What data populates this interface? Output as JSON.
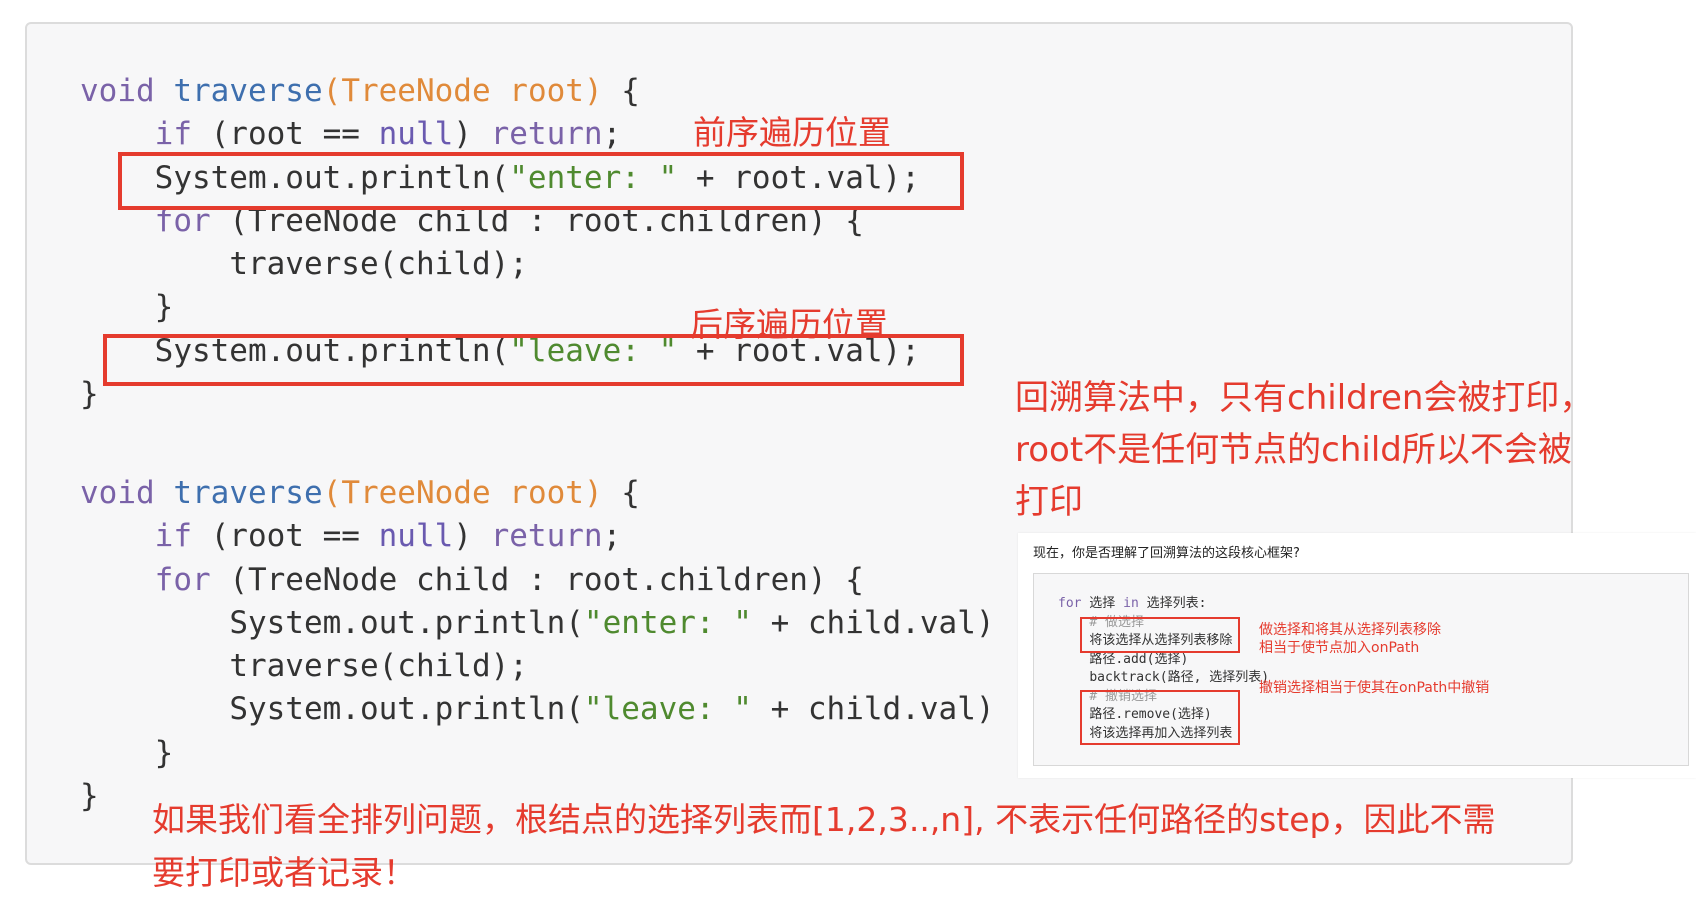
{
  "code1": {
    "l1": {
      "kw": "void",
      "fn": "traverse",
      "open": "(",
      "type": "TreeNode",
      "arg": "root",
      "close": ")",
      "rest": " {"
    },
    "l2": {
      "kw1": "if",
      "a": " (root == ",
      "null": "null",
      "b": ") ",
      "kw2": "return",
      "c": ";"
    },
    "l3": {
      "a": "System.out.println(",
      "str": "\"enter: \"",
      "b": " + root.val);"
    },
    "l4": {
      "kw": "for",
      "rest": " (TreeNode child : root.children) {"
    },
    "l5": "traverse(child);",
    "l6": "}",
    "l7": {
      "a": "System.out.println(",
      "str": "\"leave: \"",
      "b": " + root.val);"
    },
    "l8": "}"
  },
  "code2": {
    "l1": {
      "kw": "void",
      "fn": "traverse",
      "open": "(",
      "type": "TreeNode",
      "arg": "root",
      "close": ")",
      "rest": " {"
    },
    "l2": {
      "kw1": "if",
      "a": " (root == ",
      "null": "null",
      "b": ") ",
      "kw2": "return",
      "c": ";"
    },
    "l3": {
      "kw": "for",
      "rest": " (TreeNode child : root.children) {"
    },
    "l4": {
      "a": "System.out.println(",
      "str": "\"enter: \"",
      "b": " + child.val)"
    },
    "l5": "traverse(child);",
    "l6": {
      "a": "System.out.println(",
      "str": "\"leave: \"",
      "b": " + child.val)"
    },
    "l7": "}",
    "l8": "}"
  },
  "annotations": {
    "preorder": "前序遍历位置",
    "postorder": "后序遍历位置",
    "right_note": "回溯算法中，只有children会被打印，root不是任何节点的child所以不会被打印",
    "bottom_note": "如果我们看全排列问题，根结点的选择列表而[1,2,3..,n], 不表示任何路径的step，因此不需要打印或者记录！"
  },
  "inset": {
    "title": "现在，你是否理解了回溯算法的这段核心框架?",
    "code": {
      "l1": {
        "kw": "for",
        "a": " 选择 ",
        "kw2": "in",
        "b": " 选择列表:"
      },
      "l2": "# 做选择",
      "l3": "将该选择从选择列表移除",
      "l4": "路径.add(选择)",
      "l5": "backtrack(路径, 选择列表)",
      "l6": "# 撤销选择",
      "l7": "路径.remove(选择)",
      "l8": "将该选择再加入选择列表"
    },
    "note1_line1": "做选择和将其从选择列表移除",
    "note1_line2": "相当于使节点加入onPath",
    "note2": "撤销选择相当于使其在onPath中撤销"
  },
  "colors": {
    "annotation_red": "#e53b2e",
    "keyword": "#7a62a8",
    "function": "#3e6fae",
    "type": "#e08a3a",
    "string": "#4f8a2f"
  }
}
